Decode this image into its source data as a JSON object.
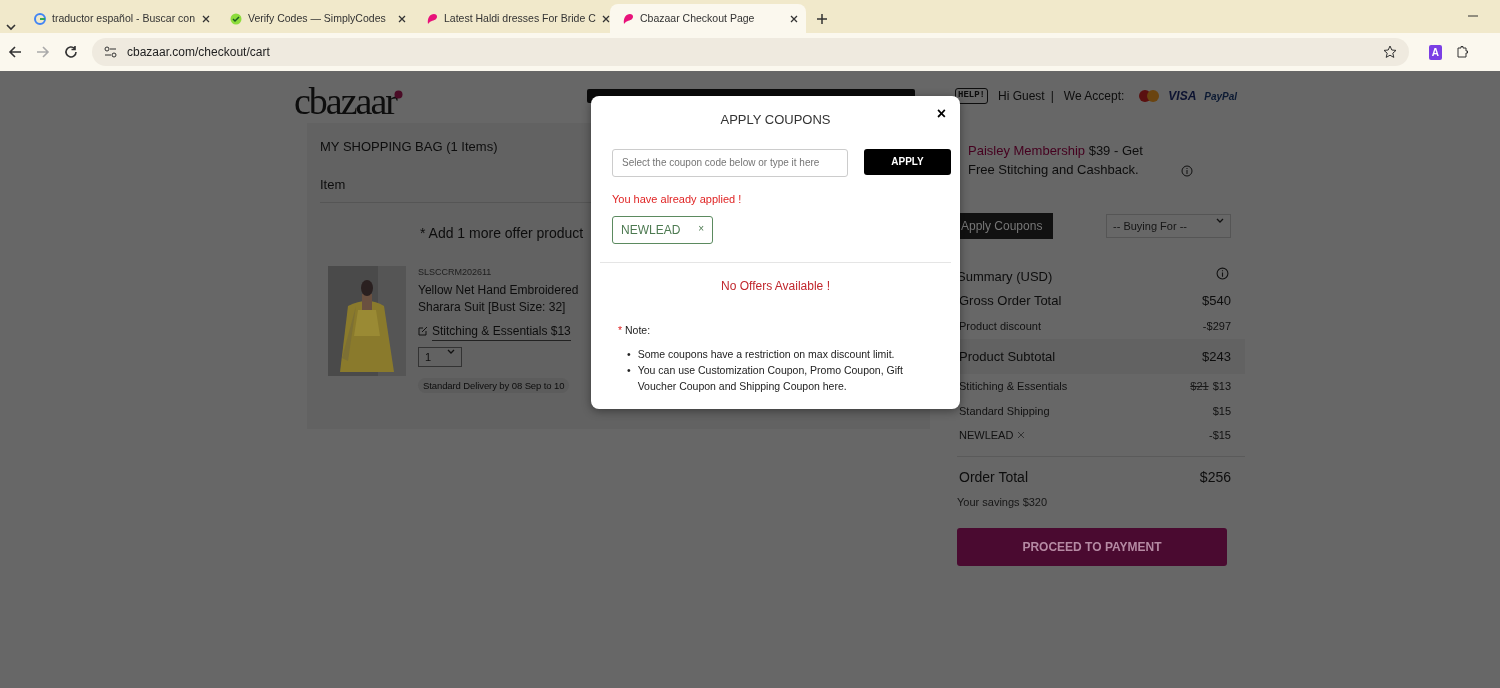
{
  "browser": {
    "tabs": [
      {
        "title": "traductor español - Buscar con",
        "selected": false
      },
      {
        "title": "Verify Codes — SimplyCodes",
        "selected": false
      },
      {
        "title": "Latest Haldi dresses For Bride C",
        "selected": false
      },
      {
        "title": "Cbazaar Checkout Page",
        "selected": true
      }
    ],
    "url": "cbazaar.com/checkout/cart",
    "profile": "A"
  },
  "header": {
    "logo": "cbazaar",
    "help": "HELP!",
    "greeting": "Hi Guest",
    "separator": "|",
    "accept_label": "We Accept:",
    "payments": [
      {
        "kind": "mastercard"
      },
      {
        "kind": "visa",
        "label": "VISA"
      },
      {
        "kind": "paypal",
        "label": "PayPal"
      }
    ]
  },
  "cart": {
    "title": "MY SHOPPING BAG (1 Items)",
    "column": "Item",
    "offer_note": "* Add 1 more offer product",
    "item": {
      "sku": "SLSCCRM202611",
      "name_lines": [
        "Yellow Net Hand Embroidered",
        "Sharara Suit [Bust Size: 32]"
      ],
      "stitching": "Stitching & Essentials $13",
      "quantity": "1",
      "delivery": "Standard Delivery by 08 Sep to 10"
    }
  },
  "membership": {
    "link": "Paisley Membership",
    "text": "$39 - Get Free Stitching and Cashback."
  },
  "apply_coupons": "Apply Coupons",
  "buying_for": "-- Buying For --",
  "summary": {
    "title": "Summary (USD)",
    "rows": [
      {
        "kind": "major",
        "label": "Gross Order Total",
        "value": "$540"
      },
      {
        "kind": "minor",
        "label": "Product discount",
        "value": "-$297"
      },
      {
        "kind": "band",
        "label": "Product Subtotal",
        "value": "$243"
      },
      {
        "kind": "minor",
        "label": "Stitiching & Essentials",
        "old_value": "$21",
        "value": "$13"
      },
      {
        "kind": "minor",
        "label": "Standard Shipping",
        "value": "$15"
      },
      {
        "kind": "coupon",
        "label": "NEWLEAD",
        "value": "-$15"
      },
      {
        "kind": "total",
        "label": "Order Total",
        "value": "$256"
      }
    ],
    "savings": "Your savings $320",
    "proceed": "PROCEED TO PAYMENT"
  },
  "modal": {
    "title": "APPLY COUPONS",
    "close": "×",
    "placeholder": "Select the coupon code below or type it here",
    "apply": "APPLY",
    "message": "You have already applied !",
    "applied": [
      {
        "code": "NEWLEAD",
        "remove": "×"
      }
    ],
    "empty": "No Offers Available !",
    "note_mark": "*",
    "note_label": "Note:",
    "bullet": "•",
    "notes": [
      "Some coupons have a restriction on max discount limit.",
      "You can use Customization Coupon, Promo Coupon, Gift Voucher Coupon and Shipping Coupon here."
    ]
  }
}
